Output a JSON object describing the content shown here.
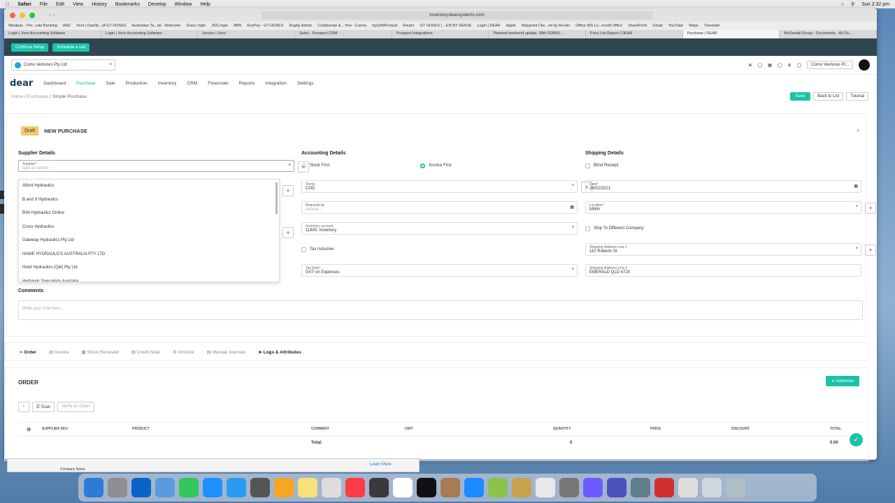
{
  "menubar": {
    "apple": "",
    "app": "Safari",
    "items": [
      "File",
      "Edit",
      "View",
      "History",
      "Bookmarks",
      "Develop",
      "Window",
      "Help"
    ],
    "clock": "Sun 2:32 pm"
  },
  "browser": {
    "url": "inventory.dearsystems.com",
    "bookmarks": [
      "Westpac - Per...rate Banking",
      "ANZ",
      "Xero | Dashb...(A GT HOSES",
      "Australian Ta...tal - Welcome",
      "Gracc login",
      "JSG login",
      "ABN",
      "KeyPay - GT HOSES",
      "Rugby Admin",
      "Collaborate &... free - Canva",
      "myQNAPcloud",
      "Router",
      "GT HOSES | ...EN BY SERVE",
      "Login | DEAR",
      "Apple",
      "Waypoint Clie...ed by Accelo",
      "Office 365 Lo...rosoft Office",
      "SharePoint",
      "Gmail",
      "YouTube",
      "Maps",
      "Translate"
    ],
    "tabs": [
      "Login | Xero Accounting Software",
      "Login | Xero Accounting Software",
      "Invoice | Xero",
      "Sales - Prospect CRM",
      "Prospect Integrations",
      "Planned weekend update: 28th FEBRU...",
      "Price List Report | DEAR",
      "Purchase | DEAR",
      "McDowall Group - Documents - All Do..."
    ]
  },
  "setup": {
    "continue": "Continue Setup",
    "schedule": "Schedule a call"
  },
  "org": {
    "name": "Como Ventures Pty Ltd",
    "right": "Como Ventures Pt..."
  },
  "nav": {
    "logo": "dear",
    "items": [
      "Dashboard",
      "Purchase",
      "Sale",
      "Production",
      "Inventory",
      "CRM",
      "Financials",
      "Reports",
      "Integration",
      "Settings"
    ]
  },
  "breadcrumb": {
    "home": "Home",
    "purchases": "Purchases",
    "current": "Simple Purchase"
  },
  "actions": {
    "save": "Save",
    "back": "Back to List",
    "tutorial": "Tutorial"
  },
  "purchase": {
    "status": "Draft",
    "title": "NEW PURCHASE"
  },
  "supplier": {
    "section": "Supplier Details",
    "label": "Supplier*",
    "placeholder": "type to search",
    "options": [
      "Alford Hydraulics",
      "B and S Hydraulics",
      "BVA Hydraulics Online",
      "Cross Hydraulics",
      "Gateway Hydraulics Pty Ltd",
      "HAWE HYDRAULICS AUSTRALIA PTY LTD",
      "Hoist Hydraulics (Qld) Pty Ltd",
      "Hydraulic Specialists Australia"
    ]
  },
  "accounting": {
    "section": "Accounting Details",
    "stock_first": "Stock First",
    "invoice_first": "Invoice First",
    "terms_label": "Terms",
    "terms": "COD",
    "required_label": "Required by",
    "required_ph": "choose...",
    "inv_label": "Inventory account",
    "inv": "11800: Inventory",
    "tax_inclusive": "Tax Inclusive",
    "tax_label": "Tax Rule*",
    "tax": "GST on Expenses"
  },
  "shipping": {
    "section": "Shipping Details",
    "blind": "Blind Receipt",
    "date_label": "Date*",
    "date": "28/02/2021",
    "loc_label": "Location*",
    "loc": "MWH",
    "ship_diff": "Ship To Different Company",
    "addr1_label": "Shipping Address Line 1",
    "addr1": "110 Roberts St",
    "addr2_label": "Shipping Address Line 2",
    "addr2": "EMERALD QLD 4720"
  },
  "comments": {
    "label": "Comments",
    "placeholder": "Write your note here..."
  },
  "subtabs": [
    "Order",
    "Invoice",
    "Stock Received",
    "Credit Note",
    "Unstock",
    "Manual Journals",
    "Logs & Attributes"
  ],
  "order": {
    "title": "ORDER",
    "authorise": "Authorise",
    "scan": "Scan",
    "verify": "Verify an Order",
    "columns": [
      "SUPPLIER SKU",
      "PRODUCT",
      "COMMENT",
      "UNIT",
      "QUANTITY",
      "PRICE",
      "DISCOUNT",
      "TOTAL"
    ],
    "total_label": "Total:",
    "total_qty": "0",
    "total_amount": "0.00"
  },
  "misc": {
    "side_time": "5:00",
    "ghost_company": "Company Name",
    "ghost_learn": "Learn More"
  }
}
